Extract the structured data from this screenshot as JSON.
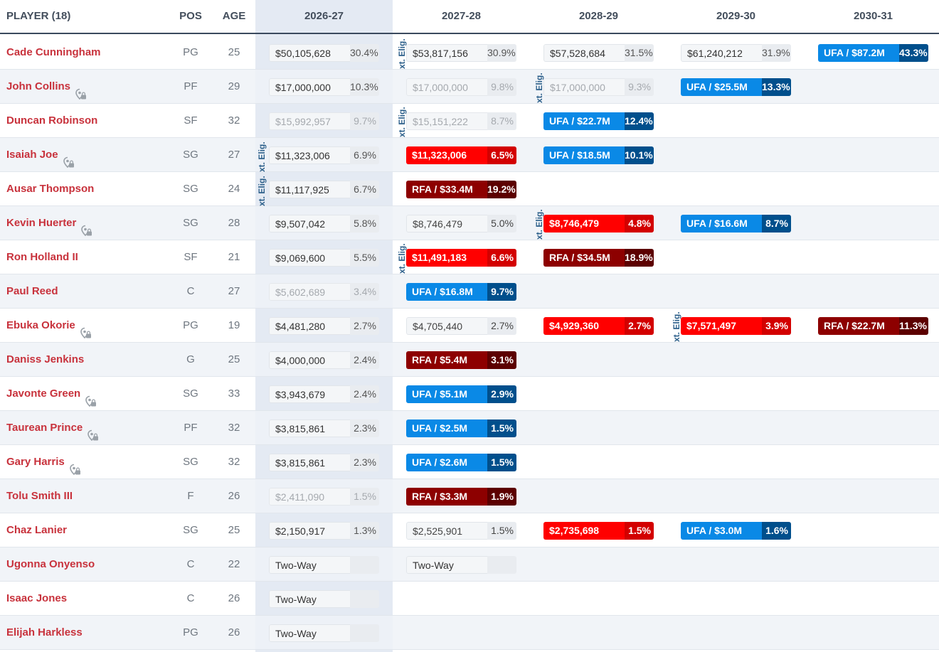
{
  "header": {
    "player": "PLAYER (18)",
    "pos": "POS",
    "age": "AGE",
    "seasons": [
      "2026-27",
      "2027-28",
      "2028-29",
      "2029-30",
      "2030-31"
    ]
  },
  "elig_label": "xt. Elig.",
  "colors": {
    "player_name": "#c8323c",
    "ufa": "#0a89e6",
    "ufa_dark": "#004f8c",
    "rfa": "#8d0000",
    "rfa_dark": "#5c0000",
    "guaranteed_red": "#ff0000",
    "header_rule": "#3b4a5e"
  },
  "rows": [
    {
      "name": "Cade Cunningham",
      "lock": false,
      "pos": "PG",
      "age": "25",
      "cells": [
        {
          "type": "normal",
          "amount": "$50,105,628",
          "pct": "30.4%"
        },
        {
          "type": "normal",
          "amount": "$53,817,156",
          "pct": "30.9%"
        },
        {
          "type": "normal",
          "amount": "$57,528,684",
          "pct": "31.5%"
        },
        {
          "type": "normal",
          "amount": "$61,240,212",
          "pct": "31.9%"
        },
        {
          "type": "ufa",
          "amount": "UFA / $87.2M",
          "pct": "43.3%"
        }
      ]
    },
    {
      "name": "John Collins",
      "lock": true,
      "pos": "PF",
      "age": "29",
      "cells": [
        {
          "type": "normal",
          "amount": "$17,000,000",
          "pct": "10.3%"
        },
        {
          "type": "option",
          "amount": "$17,000,000",
          "pct": "9.8%"
        },
        {
          "type": "option",
          "amount": "$17,000,000",
          "pct": "9.3%"
        },
        {
          "type": "ufa",
          "amount": "UFA / $25.5M",
          "pct": "13.3%"
        },
        null
      ]
    },
    {
      "name": "Duncan Robinson",
      "lock": false,
      "pos": "SF",
      "age": "32",
      "cells": [
        {
          "type": "option",
          "amount": "$15,992,957",
          "pct": "9.7%"
        },
        {
          "type": "option",
          "amount": "$15,151,222",
          "pct": "8.7%"
        },
        {
          "type": "ufa",
          "amount": "UFA / $22.7M",
          "pct": "12.4%"
        },
        null,
        null
      ]
    },
    {
      "name": "Isaiah Joe",
      "lock": true,
      "pos": "SG",
      "age": "27",
      "cells": [
        {
          "type": "normal",
          "amount": "$11,323,006",
          "pct": "6.9%"
        },
        {
          "type": "red",
          "amount": "$11,323,006",
          "pct": "6.5%"
        },
        {
          "type": "ufa",
          "amount": "UFA / $18.5M",
          "pct": "10.1%"
        },
        null,
        null
      ]
    },
    {
      "name": "Ausar Thompson",
      "lock": false,
      "pos": "SG",
      "age": "24",
      "cells": [
        {
          "type": "normal",
          "amount": "$11,117,925",
          "pct": "6.7%"
        },
        {
          "type": "rfa",
          "amount": "RFA / $33.4M",
          "pct": "19.2%"
        },
        null,
        null,
        null
      ]
    },
    {
      "name": "Kevin Huerter",
      "lock": true,
      "pos": "SG",
      "age": "28",
      "cells": [
        {
          "type": "normal",
          "amount": "$9,507,042",
          "pct": "5.8%"
        },
        {
          "type": "guarantee",
          "amount": "$8,746,479",
          "pct": "5.0%"
        },
        {
          "type": "red",
          "amount": "$8,746,479",
          "pct": "4.8%"
        },
        {
          "type": "ufa",
          "amount": "UFA / $16.6M",
          "pct": "8.7%"
        },
        null
      ]
    },
    {
      "name": "Ron Holland II",
      "lock": false,
      "pos": "SF",
      "age": "21",
      "cells": [
        {
          "type": "normal",
          "amount": "$9,069,600",
          "pct": "5.5%"
        },
        {
          "type": "red",
          "amount": "$11,491,183",
          "pct": "6.6%"
        },
        {
          "type": "rfa",
          "amount": "RFA / $34.5M",
          "pct": "18.9%"
        },
        null,
        null
      ]
    },
    {
      "name": "Paul Reed",
      "lock": false,
      "pos": "C",
      "age": "27",
      "cells": [
        {
          "type": "option",
          "amount": "$5,602,689",
          "pct": "3.4%"
        },
        {
          "type": "ufa",
          "amount": "UFA / $16.8M",
          "pct": "9.7%"
        },
        null,
        null,
        null
      ]
    },
    {
      "name": "Ebuka Okorie",
      "lock": true,
      "pos": "PG",
      "age": "19",
      "cells": [
        {
          "type": "normal",
          "amount": "$4,481,280",
          "pct": "2.7%"
        },
        {
          "type": "guarantee",
          "amount": "$4,705,440",
          "pct": "2.7%"
        },
        {
          "type": "red",
          "amount": "$4,929,360",
          "pct": "2.7%"
        },
        {
          "type": "red",
          "amount": "$7,571,497",
          "pct": "3.9%"
        },
        {
          "type": "rfa",
          "amount": "RFA / $22.7M",
          "pct": "11.3%"
        }
      ]
    },
    {
      "name": "Daniss Jenkins",
      "lock": false,
      "pos": "G",
      "age": "25",
      "cells": [
        {
          "type": "normal",
          "amount": "$4,000,000",
          "pct": "2.4%"
        },
        {
          "type": "rfa",
          "amount": "RFA / $5.4M",
          "pct": "3.1%"
        },
        null,
        null,
        null
      ]
    },
    {
      "name": "Javonte Green",
      "lock": true,
      "pos": "SG",
      "age": "33",
      "cells": [
        {
          "type": "normal",
          "amount": "$3,943,679",
          "pct": "2.4%"
        },
        {
          "type": "ufa",
          "amount": "UFA / $5.1M",
          "pct": "2.9%"
        },
        null,
        null,
        null
      ]
    },
    {
      "name": "Taurean Prince",
      "lock": true,
      "pos": "PF",
      "age": "32",
      "cells": [
        {
          "type": "normal",
          "amount": "$3,815,861",
          "pct": "2.3%"
        },
        {
          "type": "ufa",
          "amount": "UFA / $2.5M",
          "pct": "1.5%"
        },
        null,
        null,
        null
      ]
    },
    {
      "name": "Gary Harris",
      "lock": true,
      "pos": "SG",
      "age": "32",
      "cells": [
        {
          "type": "normal",
          "amount": "$3,815,861",
          "pct": "2.3%"
        },
        {
          "type": "ufa",
          "amount": "UFA / $2.6M",
          "pct": "1.5%"
        },
        null,
        null,
        null
      ]
    },
    {
      "name": "Tolu Smith III",
      "lock": false,
      "pos": "F",
      "age": "26",
      "cells": [
        {
          "type": "option",
          "amount": "$2,411,090",
          "pct": "1.5%"
        },
        {
          "type": "rfa",
          "amount": "RFA / $3.3M",
          "pct": "1.9%"
        },
        null,
        null,
        null
      ]
    },
    {
      "name": "Chaz Lanier",
      "lock": false,
      "pos": "SG",
      "age": "25",
      "cells": [
        {
          "type": "normal",
          "amount": "$2,150,917",
          "pct": "1.3%"
        },
        {
          "type": "guarantee",
          "amount": "$2,525,901",
          "pct": "1.5%"
        },
        {
          "type": "red",
          "amount": "$2,735,698",
          "pct": "1.5%"
        },
        {
          "type": "ufa",
          "amount": "UFA / $3.0M",
          "pct": "1.6%"
        },
        null
      ]
    },
    {
      "name": "Ugonna Onyenso",
      "lock": false,
      "pos": "C",
      "age": "22",
      "cells": [
        {
          "type": "twoway",
          "amount": "Two-Way",
          "pct": ""
        },
        {
          "type": "twoway",
          "amount": "Two-Way",
          "pct": ""
        },
        null,
        null,
        null
      ]
    },
    {
      "name": "Isaac Jones",
      "lock": false,
      "pos": "C",
      "age": "26",
      "cells": [
        {
          "type": "twoway",
          "amount": "Two-Way",
          "pct": ""
        },
        null,
        null,
        null,
        null
      ]
    },
    {
      "name": "Elijah Harkless",
      "lock": false,
      "pos": "PG",
      "age": "26",
      "cells": [
        {
          "type": "twoway",
          "amount": "Two-Way",
          "pct": ""
        },
        null,
        null,
        null,
        null
      ]
    }
  ],
  "elig_markers": [
    {
      "row": 0,
      "before_col": 1
    },
    {
      "row": 1,
      "before_col": 2
    },
    {
      "row": 2,
      "before_col": 1
    },
    {
      "row": 3,
      "before_col": 0,
      "double": true
    },
    {
      "row": 5,
      "before_col": 2
    },
    {
      "row": 6,
      "before_col": 1
    },
    {
      "row": 8,
      "before_col": 3
    }
  ]
}
